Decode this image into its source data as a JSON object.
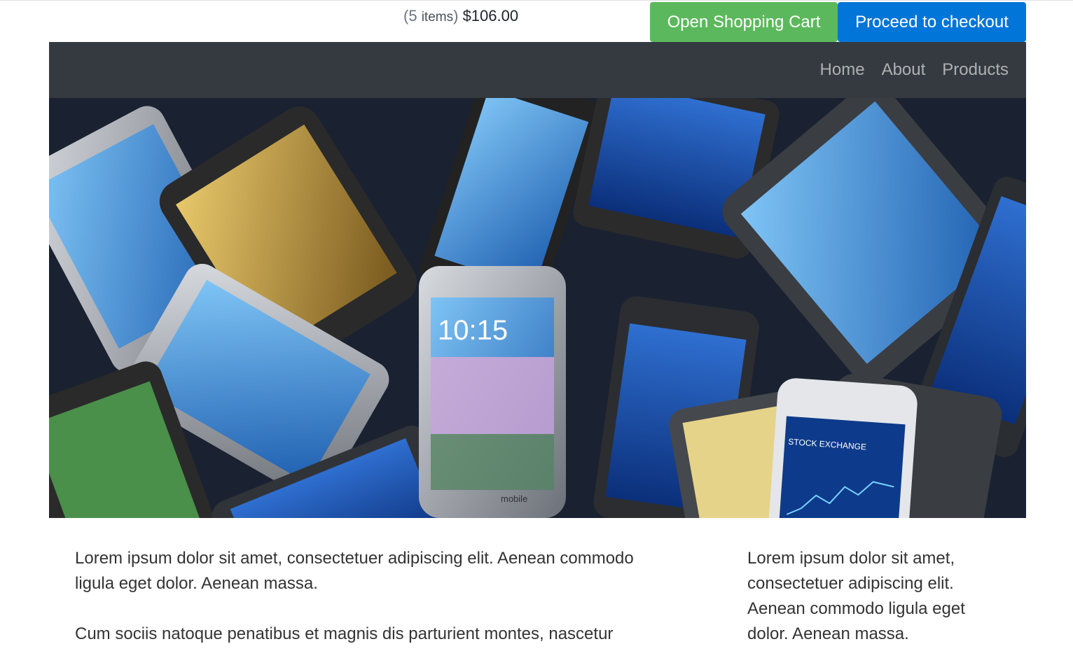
{
  "cart": {
    "count": "5",
    "items_label": "items",
    "total": "$106.00"
  },
  "buttons": {
    "open_cart": "Open Shopping Cart",
    "checkout": "Proceed to checkout"
  },
  "nav": {
    "items": [
      {
        "label": "Home"
      },
      {
        "label": "About"
      },
      {
        "label": "Products"
      }
    ]
  },
  "carousel": {
    "slide_count": 3,
    "active_index": 0,
    "phone_texts": [
      "10:15",
      "mobile",
      "STOCK EXCHANGE"
    ]
  },
  "content": {
    "left_paragraphs": [
      "Lorem ipsum dolor sit amet, consectetuer adipiscing elit. Aenean commodo ligula eget dolor. Aenean massa.",
      "Cum sociis natoque penatibus et magnis dis parturient montes, nascetur"
    ],
    "right_paragraph": "Lorem ipsum dolor sit amet, consectetuer adipiscing elit. Aenean commodo ligula eget dolor. Aenean massa."
  },
  "colors": {
    "cart_button": "#5cb85c",
    "checkout_button": "#0275d8",
    "navbar": "#343a40"
  }
}
